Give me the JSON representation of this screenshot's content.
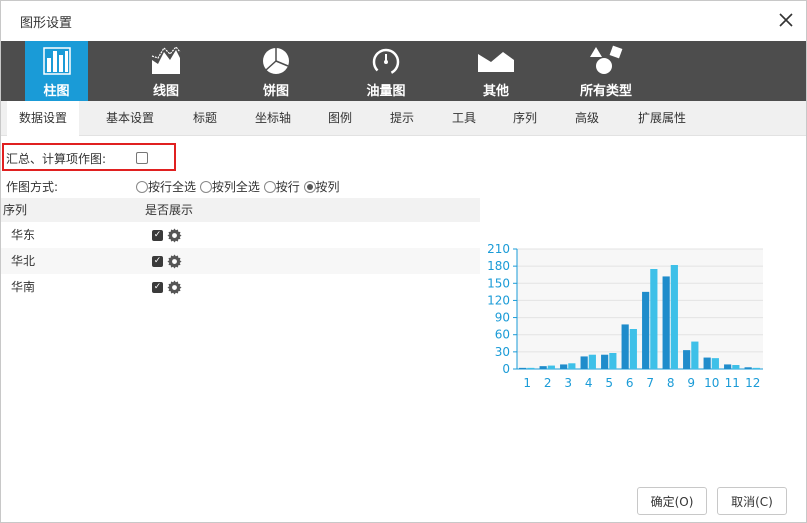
{
  "dialog": {
    "title": "图形设置"
  },
  "chart_types": [
    {
      "label": "柱图",
      "icon": "bar-chart-icon",
      "active": true
    },
    {
      "label": "线图",
      "icon": "line-chart-icon",
      "active": false
    },
    {
      "label": "饼图",
      "icon": "pie-chart-icon",
      "active": false
    },
    {
      "label": "油量图",
      "icon": "gauge-icon",
      "active": false
    },
    {
      "label": "其他",
      "icon": "other-chart-icon",
      "active": false
    },
    {
      "label": "所有类型",
      "icon": "all-types-icon",
      "active": false
    }
  ],
  "tabs": [
    {
      "label": "数据设置",
      "active": true
    },
    {
      "label": "基本设置",
      "active": false
    },
    {
      "label": "标题",
      "active": false
    },
    {
      "label": "坐标轴",
      "active": false
    },
    {
      "label": "图例",
      "active": false
    },
    {
      "label": "提示",
      "active": false
    },
    {
      "label": "工具",
      "active": false
    },
    {
      "label": "序列",
      "active": false
    },
    {
      "label": "高级",
      "active": false
    },
    {
      "label": "扩展属性",
      "active": false
    }
  ],
  "options": {
    "summary_label": "汇总、计算项作图:",
    "summary_checked": false,
    "mode_label": "作图方式:",
    "modes": [
      {
        "label": "按行全选",
        "selected": false
      },
      {
        "label": "按列全选",
        "selected": false
      },
      {
        "label": "按行",
        "selected": false
      },
      {
        "label": "按列",
        "selected": true
      }
    ]
  },
  "series_table": {
    "headers": [
      "序列",
      "是否展示"
    ],
    "rows": [
      {
        "name": "华东",
        "shown": true
      },
      {
        "name": "华北",
        "shown": true
      },
      {
        "name": "华南",
        "shown": true
      }
    ]
  },
  "chart_data": {
    "type": "bar",
    "categories": [
      "1",
      "2",
      "3",
      "4",
      "5",
      "6",
      "7",
      "8",
      "9",
      "10",
      "11",
      "12"
    ],
    "series": [
      {
        "values": [
          2,
          5,
          8,
          22,
          25,
          78,
          135,
          162,
          33,
          20,
          8,
          3
        ]
      },
      {
        "values": [
          2,
          6,
          10,
          25,
          28,
          70,
          175,
          182,
          48,
          19,
          7,
          2
        ]
      }
    ],
    "ylim": [
      0,
      210
    ],
    "yticks": [
      0,
      30,
      60,
      90,
      120,
      150,
      180,
      210
    ],
    "grid": true,
    "colors": [
      "#1f8ccb",
      "#3ec0e8"
    ],
    "axis_color": "#1a9bd7"
  },
  "buttons": {
    "ok": "确定(O)",
    "cancel": "取消(C)"
  },
  "colors": {
    "type_bar_bg": "#4d4d4d",
    "active_accent": "#1a9bd7",
    "highlight_border": "#e02020"
  }
}
